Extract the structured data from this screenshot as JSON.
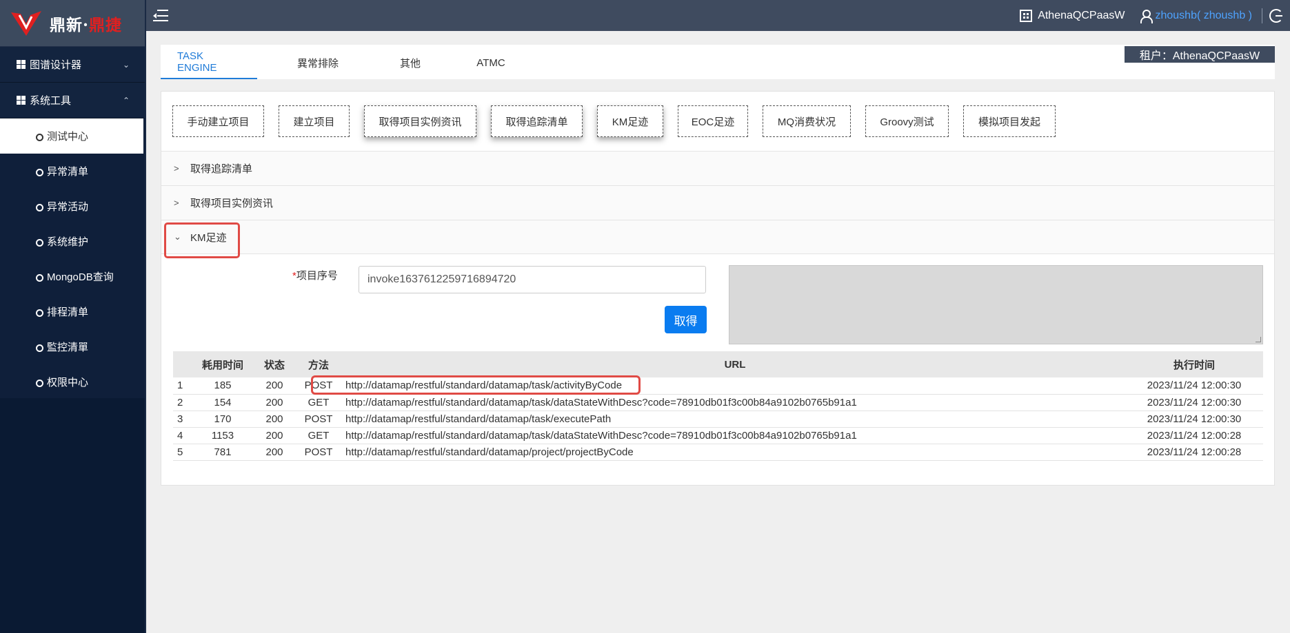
{
  "brand": {
    "name_a": "鼎新",
    "sep": "·",
    "name_b": "鼎捷"
  },
  "sidebar": {
    "groups": [
      {
        "label": "图谱设计器",
        "chevron": "⌄"
      },
      {
        "label": "系统工具",
        "chevron": "⌃"
      }
    ],
    "items": [
      {
        "label": "测试中心"
      },
      {
        "label": "异常清单"
      },
      {
        "label": "异常活动"
      },
      {
        "label": "系统维护"
      },
      {
        "label": "MongoDB查询"
      },
      {
        "label": "排程清单"
      },
      {
        "label": "監控清單"
      },
      {
        "label": "权限中心"
      }
    ]
  },
  "topbar": {
    "tenant": "AthenaQCPaasW",
    "user": "zhoushb( zhoushb )"
  },
  "tabs": [
    {
      "label": "TASK ENGINE"
    },
    {
      "label": "異常排除"
    },
    {
      "label": "其他"
    },
    {
      "label": "ATMC"
    }
  ],
  "tenant_badge": "租户：AthenaQCPaasW",
  "tool_buttons": [
    "手动建立项目",
    "建立项目",
    "取得项目实例资讯",
    "取得追踪清单",
    "KM足迹",
    "EOC足迹",
    "MQ消费状况",
    "Groovy测试",
    "模拟项目发起"
  ],
  "accordion": [
    {
      "label": "取得追踪清单",
      "arrow": ">"
    },
    {
      "label": "取得项目实例资讯",
      "arrow": ">"
    },
    {
      "label": "KM足迹",
      "arrow": "⌄"
    }
  ],
  "form": {
    "required_mark": "*",
    "field_label": "项目序号",
    "field_value": "invoke1637612259716894720",
    "submit_label": "取得"
  },
  "table": {
    "headers": {
      "time": "耗用时间",
      "status": "状态",
      "method": "方法",
      "url": "URL",
      "exec": "执行时间"
    },
    "rows": [
      {
        "idx": "1",
        "time": "185",
        "status": "200",
        "method": "POST",
        "url": "http://datamap/restful/standard/datamap/task/activityByCode",
        "exec": "2023/11/24 12:00:30"
      },
      {
        "idx": "2",
        "time": "154",
        "status": "200",
        "method": "GET",
        "url": "http://datamap/restful/standard/datamap/task/dataStateWithDesc?code=78910db01f3c00b84a9102b0765b91a1",
        "exec": "2023/11/24 12:00:30"
      },
      {
        "idx": "3",
        "time": "170",
        "status": "200",
        "method": "POST",
        "url": "http://datamap/restful/standard/datamap/task/executePath",
        "exec": "2023/11/24 12:00:30"
      },
      {
        "idx": "4",
        "time": "1153",
        "status": "200",
        "method": "GET",
        "url": "http://datamap/restful/standard/datamap/task/dataStateWithDesc?code=78910db01f3c00b84a9102b0765b91a1",
        "exec": "2023/11/24 12:00:28"
      },
      {
        "idx": "5",
        "time": "781",
        "status": "200",
        "method": "POST",
        "url": "http://datamap/restful/standard/datamap/project/projectByCode",
        "exec": "2023/11/24 12:00:28"
      }
    ]
  },
  "colors": {
    "accent": "#1f7bd8",
    "primary_button": "#0a7cf0",
    "highlight": "#e04a45",
    "sidebar_bg": "#0f1f3a",
    "topbar_bg": "#3f4b5f"
  }
}
